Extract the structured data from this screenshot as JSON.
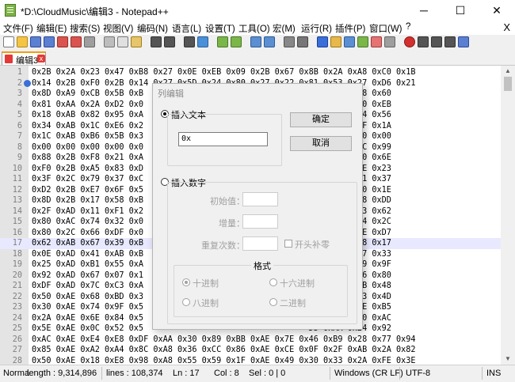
{
  "window": {
    "title": "*D:\\CloudMusic\\编辑3 - Notepad++",
    "minimize": "─",
    "maximize": "☐",
    "close": "✕"
  },
  "menu": {
    "items": [
      "文件(F)",
      "编辑(E)",
      "搜索(S)",
      "视图(V)",
      "编码(N)",
      "语言(L)",
      "设置(T)",
      "工具(O)",
      "宏(M)",
      "运行(R)",
      "插件(P)",
      "窗口(W)",
      "?"
    ],
    "close_label": "X"
  },
  "tab": {
    "label": "编辑3",
    "close": "x"
  },
  "editor": {
    "lines": [
      {
        "n": "1",
        "text": "0x2B 0x2A 0x23 0x47 0xB8 0x27 0x0E 0xEB 0x09 0x2B 0x67 0x8B 0x2A 0xA8 0xC0 0x1B"
      },
      {
        "n": "2",
        "text": "0x14 0x2B 0xF0 0x2B 0x14 0x27 0x5D 0x24 0x80 0x27 0x22 0x81 0x53 0x27 0xD6 0x21"
      },
      {
        "n": "3",
        "text": "0x8D 0xA9 0xCB 0x5B 0xB                                  98 0x28 0x58 0x60"
      },
      {
        "n": "4",
        "text": "0x81 0xAA 0x2A 0xD2 0x0                                  78 0x28 0x90 0xEB"
      },
      {
        "n": "5",
        "text": "0x18 0xAB 0x82 0x95 0xA                                  BC 0xA8 0x54 0x56"
      },
      {
        "n": "6",
        "text": "0x34 0xAB 0x1C 0xE6 0x2                                  00 0x28 0x3F 0x1A"
      },
      {
        "n": "7",
        "text": "0x1C 0xAB 0xB6 0x5B 0x3                                  91 0x28 0x00 0x00"
      },
      {
        "n": "8",
        "text": "0x00 0x00 0x00 0x00 0x0                                  AE 0xA8 0x6C 0x99"
      },
      {
        "n": "9",
        "text": "0x88 0x2B 0xF8 0x21 0xA                                  A8 0xA8 0x10 0x6E"
      },
      {
        "n": "10",
        "text": "0xF0 0x2B 0xA5 0x83 0xD                                  8D 0x29 0x3E 0x23"
      },
      {
        "n": "11",
        "text": "0x3F 0x2C 0x79 0x37 0xC                                  C0 0xA9 0x21 0x37"
      },
      {
        "n": "12",
        "text": "0xD2 0x2B 0xE7 0x6F 0x5                                  55 0xAA 0xE0 0x1E"
      },
      {
        "n": "13",
        "text": "0x8D 0x2B 0x17 0x58 0xB                                  60 0xA9 0xD8 0xDD"
      },
      {
        "n": "14",
        "text": "0x2F 0xAD 0x11 0xF1 0x2                                  5F 0x2A 0x33 0x62"
      },
      {
        "n": "15",
        "text": "0x80 0xAC 0x74 0x32 0x0                                  7F 0x2A 0xB4 0x2C"
      },
      {
        "n": "16",
        "text": "0x80 0x2C 0x66 0xDF 0x0                                  5F 0xAA 0xDE 0xD7"
      },
      {
        "n": "17",
        "text": "0x62 0xAB 0x67 0x39 0xB                                  22 0xAB 0x18 0x17"
      },
      {
        "n": "18",
        "text": "0x0E 0xAD 0x41 0xAB 0xB                                  D6 0xAA 0x07 0x33"
      },
      {
        "n": "19",
        "text": "0x25 0xAD 0xB1 0x55 0xA                                  06 0x2A 0xD9 0x9F"
      },
      {
        "n": "20",
        "text": "0x92 0xAD 0x67 0x07 0x1                                  99 0xAA 0x76 0x80"
      },
      {
        "n": "21",
        "text": "0xDF 0xAD 0x7C 0xC3 0xA                                  B1 0xA9 0x5B 0x48"
      },
      {
        "n": "22",
        "text": "0x50 0xAE 0x68 0xBD 0x3                                  4B 0xAA 0xD3 0x4D"
      },
      {
        "n": "23",
        "text": "0x30 0xAE 0x74 0x9F 0x5                                  99 0x2A 0x2E 0xB5"
      },
      {
        "n": "24",
        "text": "0x2A 0xAE 0x6E 0x84 0x5                                  5D 0x2A 0xA0 0xAC"
      },
      {
        "n": "25",
        "text": "0x5E 0xAE 0x0C 0x52 0x5                                  D5 0xAA 0x24 0x92"
      },
      {
        "n": "26",
        "text": "0xAC 0xAE 0xE4 0xE8 0xDF 0xAA 0x30 0x89 0xBB 0xAE 0x7E 0x46 0xB9 0x28 0x77 0x94"
      },
      {
        "n": "27",
        "text": "0x85 0xAE 0xA2 0xA4 0x8C 0xA8 0x36 0xCC 0x86 0xAE 0xCE 0x0F 0x2F 0xAB 0x2A 0x82"
      },
      {
        "n": "28",
        "text": "0x50 0xAE 0x18 0xE8 0x98 0xA8 0x55 0x59 0x1F 0xAE 0x49 0x30 0x33 0x2A 0xFE 0x3E"
      }
    ]
  },
  "status": {
    "doc_type": "Norma",
    "length": "length : 9,314,896",
    "lines": "lines : 108,374",
    "ln": "Ln : 17",
    "col": "Col : 8",
    "sel": "Sel : 0 | 0",
    "eol": "Windows (CR LF)",
    "encoding": "UTF-8",
    "ins": "INS"
  },
  "dialog": {
    "title": "列编辑",
    "insert_text_label": "插入文本",
    "insert_text_value": "0x",
    "ok_button": "确定",
    "cancel_button": "取消",
    "insert_number_label": "插入数字",
    "initial_label": "初始值：",
    "increment_label": "增量：",
    "repeat_label": "重复次数：",
    "leading_zero_label": "开头补零",
    "format_title": "格式",
    "format_options": [
      "十进制",
      "十六进制",
      "八进制",
      "二进制"
    ]
  },
  "colors": {
    "tab_accent": "#f39c12",
    "current_line": "#e8e8ff",
    "bookmark": "#3a6fd8"
  }
}
